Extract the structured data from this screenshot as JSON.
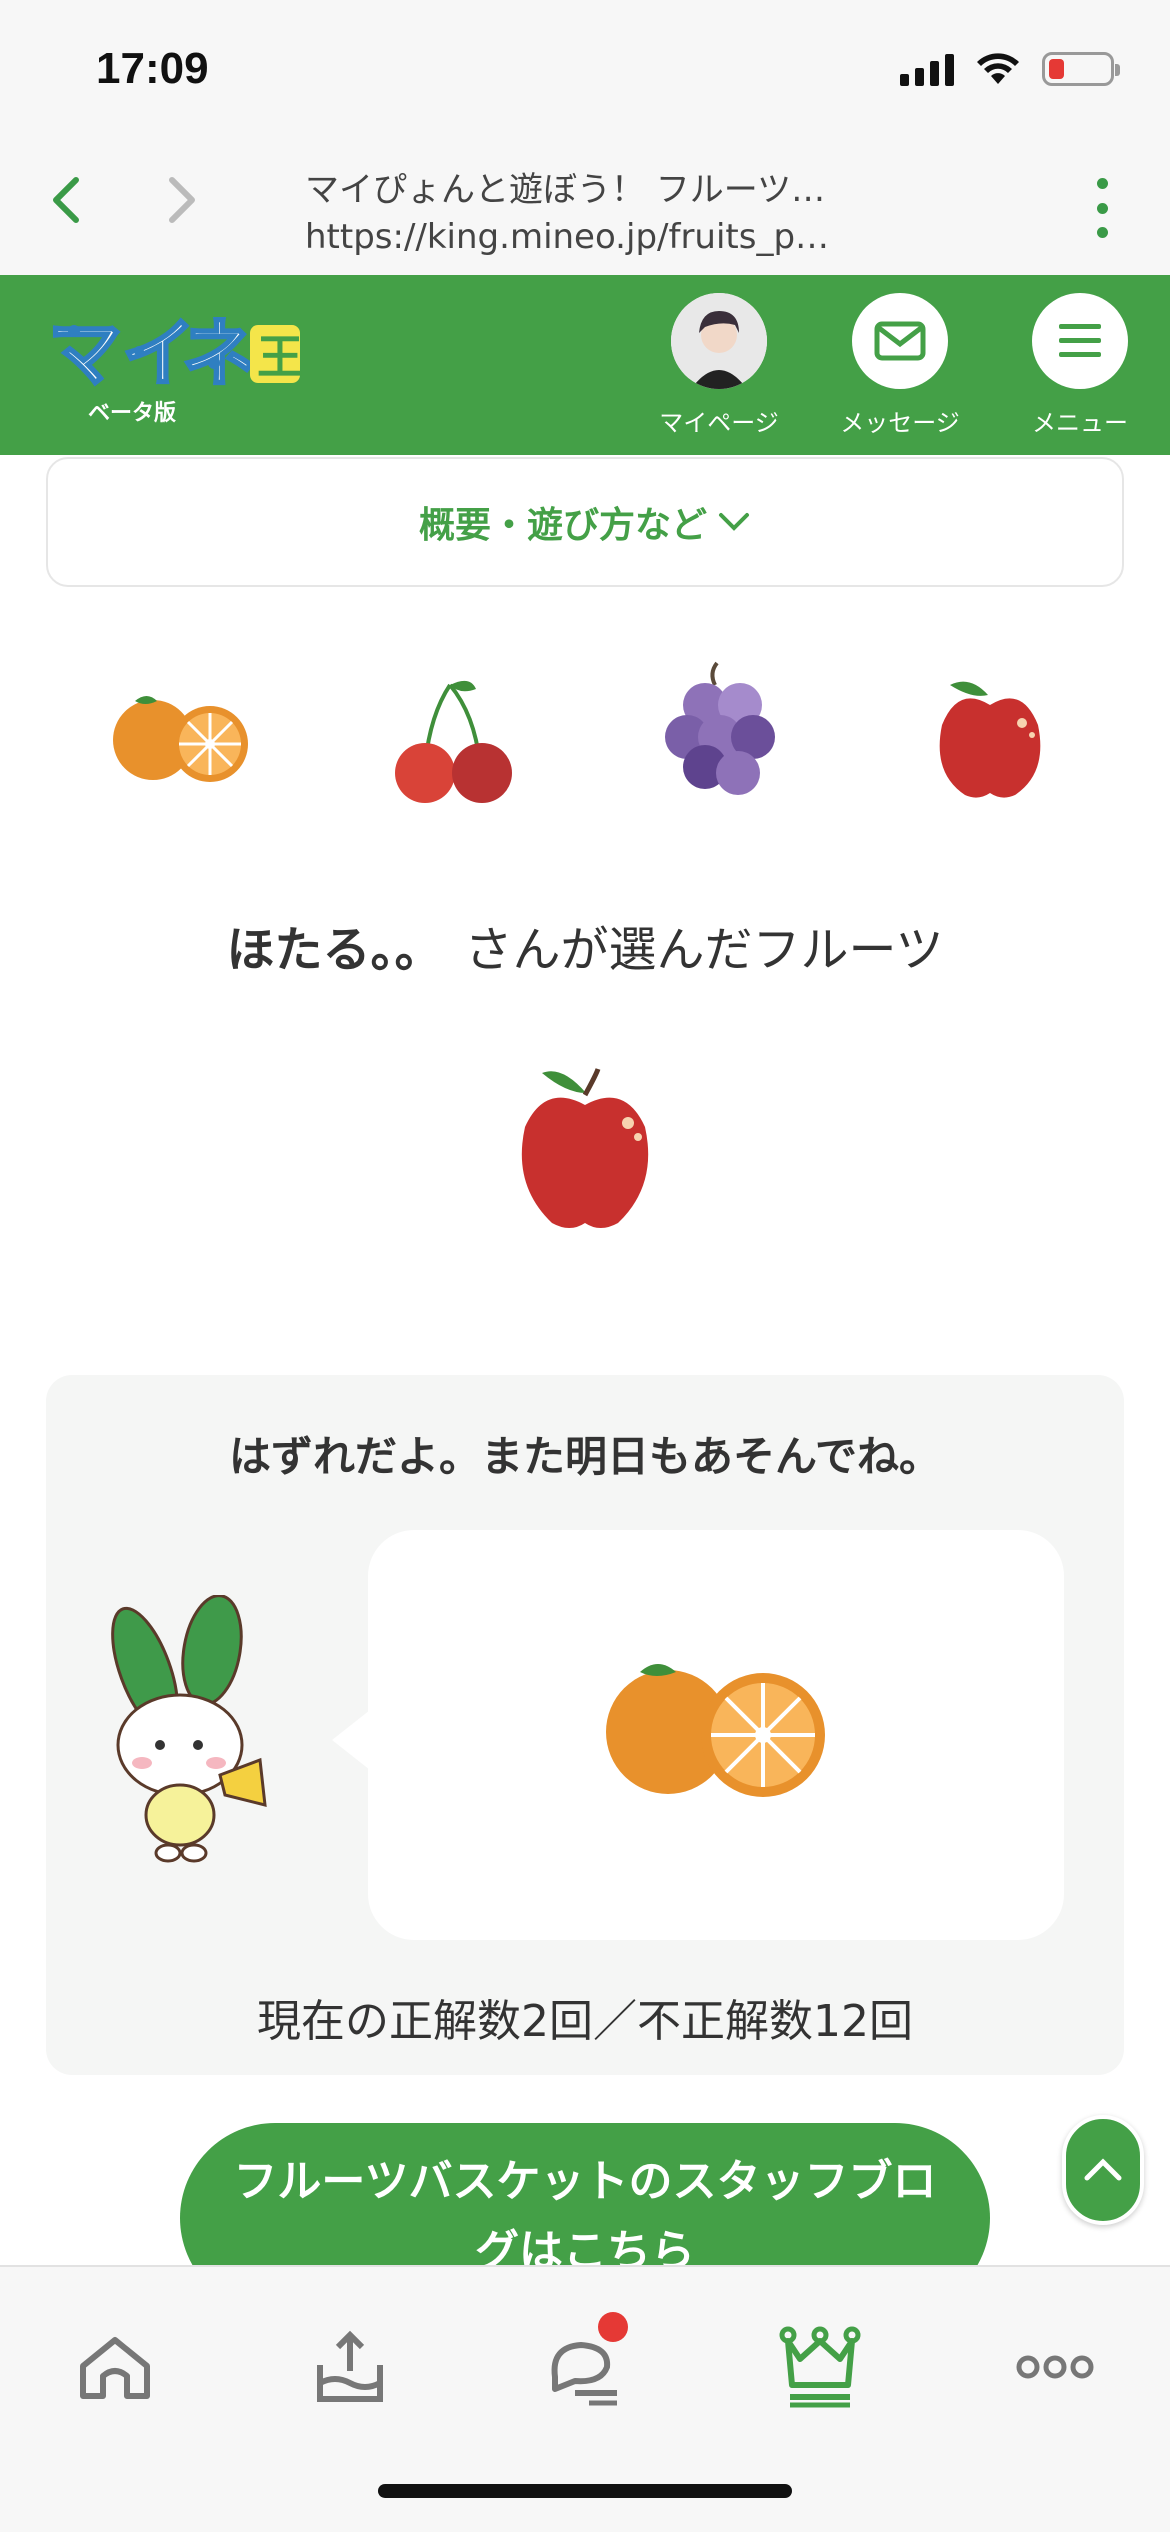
{
  "status_bar": {
    "time": "17:09"
  },
  "browser": {
    "page_title": "マイぴょんと遊ぼう！ フルーツ…",
    "url": "https://king.mineo.jp/fruits_p…"
  },
  "site_header": {
    "logo_sub": "ベータ版",
    "mypage_label": "マイページ",
    "message_label": "メッセージ",
    "menu_label": "メニュー"
  },
  "overview": {
    "label": "概要・遊び方など"
  },
  "fruits": [
    "orange",
    "cherry",
    "grape",
    "apple"
  ],
  "selection": {
    "user": "ほたる。。",
    "suffix": "さんが選んだフルーツ",
    "fruit": "apple"
  },
  "result": {
    "title": "はずれだよ。また明日もあそんでね。",
    "fruit": "orange",
    "score": "現在の正解数2回／不正解数12回"
  },
  "staff_blog_button": {
    "label": "フルーツバスケットのスタッフブログはこちら"
  },
  "tabbar": {
    "items": [
      "home-icon",
      "upload-icon",
      "chat-icon",
      "crown-icon",
      "more-icon"
    ]
  },
  "colors": {
    "brand_green": "#44a047",
    "notification": "#e53935"
  }
}
